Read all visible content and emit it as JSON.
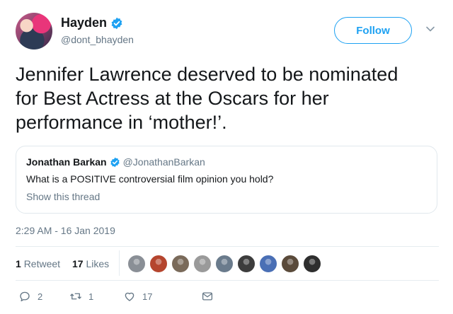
{
  "author": {
    "display_name": "Hayden",
    "handle": "@dont_bhayden",
    "verified": true
  },
  "follow_label": "Follow",
  "tweet": {
    "text_line1": "Jennifer Lawrence deserved to be nominated",
    "text_line2": "for Best Actress at the Oscars for her",
    "text_line3": "performance in ‘mother!’."
  },
  "quoted": {
    "display_name": "Jonathan Barkan",
    "handle": "@JonathanBarkan",
    "text": "What is a POSITIVE controversial film opinion you hold?",
    "show_thread": "Show this thread"
  },
  "timestamp": "2:29 AM - 16 Jan 2019",
  "stats": {
    "retweets_count": "1",
    "retweets_label": "Retweet",
    "likes_count": "17",
    "likes_label": "Likes"
  },
  "liker_avatar_colors": [
    "#8a8f96",
    "#b5452e",
    "#7a6a5a",
    "#9a9a9a",
    "#6a7b8c",
    "#3d3d3d",
    "#4a6fb5",
    "#5a4a3a",
    "#2e2e2e"
  ],
  "actions": {
    "reply_count": "2",
    "retweet_count": "1",
    "like_count": "17"
  },
  "colors": {
    "accent": "#1da1f2",
    "muted": "#657786",
    "text": "#14171a",
    "border": "#e1e8ed"
  }
}
